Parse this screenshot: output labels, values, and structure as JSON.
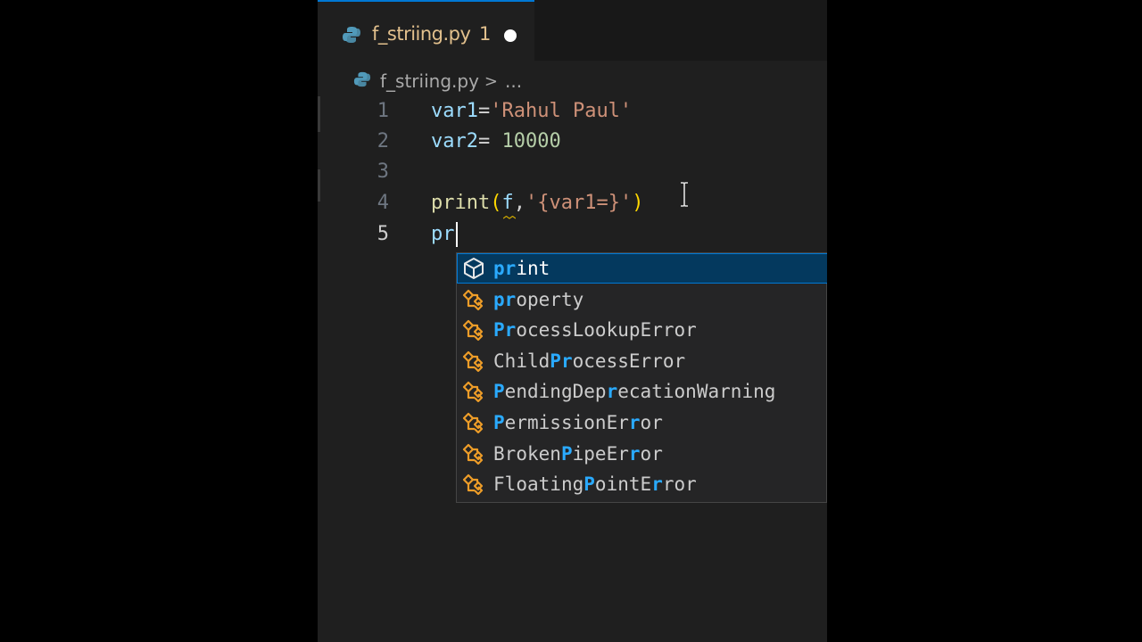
{
  "tab": {
    "filename": "f_striing.py",
    "problem_count": "1",
    "icon": "python-icon",
    "dirty": true
  },
  "breadcrumb": {
    "file": "f_striing.py",
    "separator": ">",
    "more": "..."
  },
  "editor": {
    "lines": [
      {
        "number": "1",
        "tokens": [
          [
            "var",
            "var1"
          ],
          [
            "op",
            "="
          ],
          [
            "str",
            "'Rahul Paul'"
          ]
        ]
      },
      {
        "number": "2",
        "tokens": [
          [
            "var",
            "var2"
          ],
          [
            "op",
            "= "
          ],
          [
            "num",
            "10000"
          ]
        ]
      },
      {
        "number": "3",
        "tokens": []
      },
      {
        "number": "4",
        "tokens": [
          [
            "fn",
            "print"
          ],
          [
            "paren",
            "("
          ],
          [
            "var",
            "f"
          ],
          [
            "op",
            ","
          ],
          [
            "str",
            "'{var1=}'"
          ],
          [
            "paren",
            ")"
          ]
        ]
      },
      {
        "number": "5",
        "tokens": [
          [
            "var",
            "pr"
          ]
        ]
      }
    ]
  },
  "suggestions": {
    "items": [
      {
        "label": "print",
        "kind": "method-cube-icon",
        "selected": true,
        "match": [
          0,
          1
        ]
      },
      {
        "label": "property",
        "kind": "class-icon",
        "selected": false,
        "match": [
          0,
          1
        ]
      },
      {
        "label": "ProcessLookupError",
        "kind": "class-icon",
        "selected": false,
        "match": [
          0,
          1
        ]
      },
      {
        "label": "ChildProcessError",
        "kind": "class-icon",
        "selected": false,
        "match": [
          5,
          6
        ]
      },
      {
        "label": "PendingDeprecationWarning",
        "kind": "class-icon",
        "selected": false,
        "match": [
          0,
          10
        ]
      },
      {
        "label": "PermissionError",
        "kind": "class-icon",
        "selected": false,
        "match": [
          0,
          12
        ]
      },
      {
        "label": "BrokenPipeError",
        "kind": "class-icon",
        "selected": false,
        "match": [
          6,
          12
        ]
      },
      {
        "label": "FloatingPointError",
        "kind": "class-icon",
        "selected": false,
        "match": [
          8,
          14
        ]
      }
    ]
  },
  "colors": {
    "accent": "#0078d4",
    "match_highlight": "#2aaaff",
    "class_icon": "#ee9d28"
  }
}
